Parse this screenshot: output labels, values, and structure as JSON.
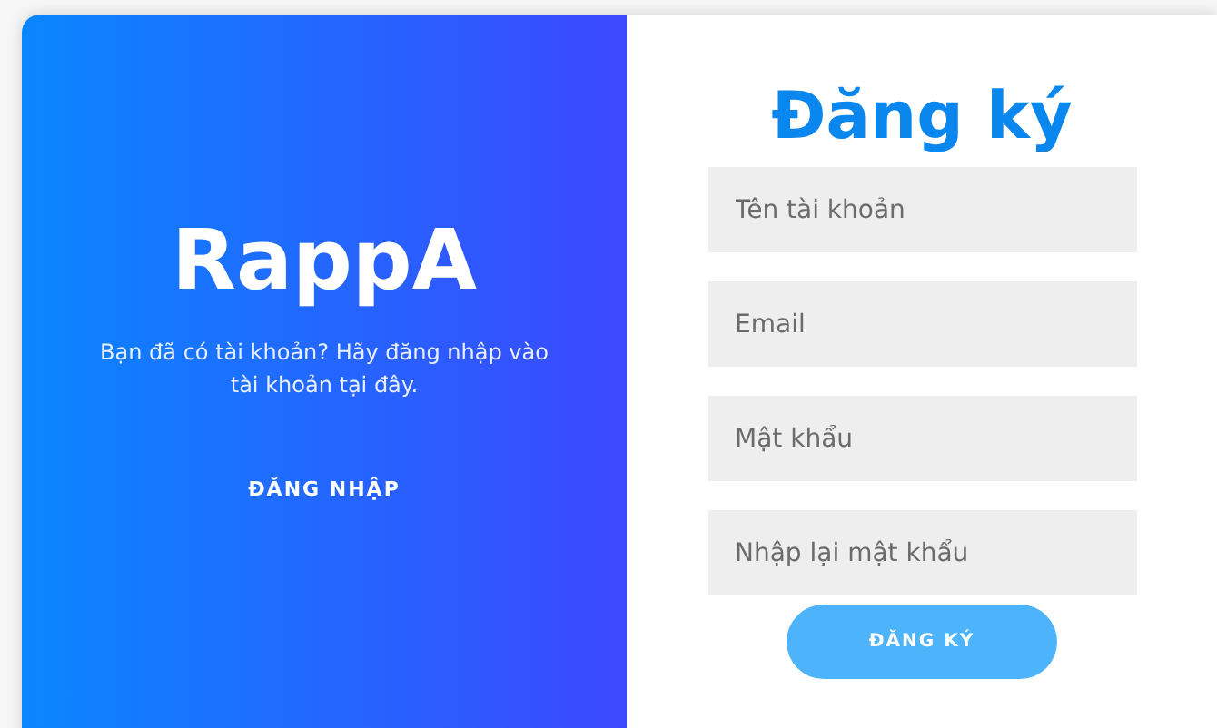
{
  "left_panel": {
    "brand": "RappA",
    "message": "Bạn đã có tài khoản? Hãy đăng nhập vào tài khoản tại đây.",
    "login_button": "ĐĂNG NHẬP"
  },
  "form": {
    "title": "Đăng ký",
    "fields": [
      {
        "placeholder": "Tên tài khoản"
      },
      {
        "placeholder": "Email"
      },
      {
        "placeholder": "Mật khẩu"
      },
      {
        "placeholder": "Nhập lại mật khẩu"
      }
    ],
    "submit_button": "ĐĂNG KÝ"
  }
}
